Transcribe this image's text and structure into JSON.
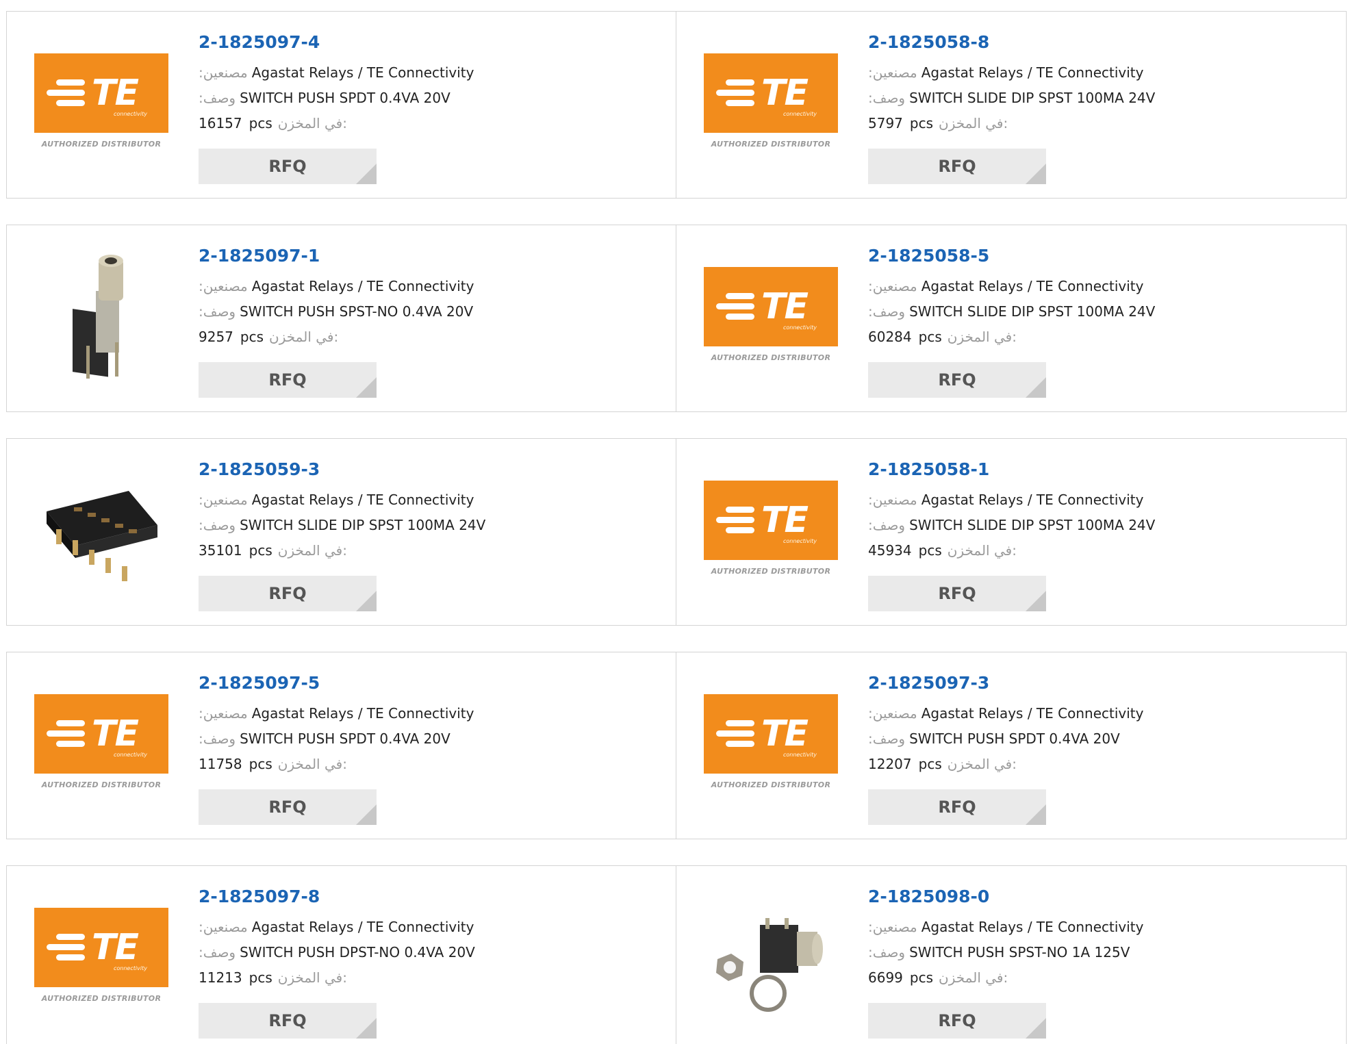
{
  "labels": {
    "manufacturer": ":مصنعين",
    "description": ":وصف",
    "stock": "في المخزن:",
    "unit": "pcs",
    "rfq": "RFQ"
  },
  "logo": {
    "word": "TE",
    "sub": "connectivity",
    "authorized": "AUTHORIZED DISTRIBUTOR",
    "accent": "#f28c1c"
  },
  "products": [
    {
      "part": "2-1825097-4",
      "manufacturer": "Agastat Relays / TE Connectivity",
      "description": "SWITCH PUSH SPDT 0.4VA 20V",
      "stock": "16157",
      "image": "te-logo"
    },
    {
      "part": "2-1825058-8",
      "manufacturer": "Agastat Relays / TE Connectivity",
      "description": "SWITCH SLIDE DIP SPST 100MA 24V",
      "stock": "5797",
      "image": "te-logo"
    },
    {
      "part": "2-1825097-1",
      "manufacturer": "Agastat Relays / TE Connectivity",
      "description": "SWITCH PUSH SPST-NO 0.4VA 20V",
      "stock": "9257",
      "image": "push-switch-photo"
    },
    {
      "part": "2-1825058-5",
      "manufacturer": "Agastat Relays / TE Connectivity",
      "description": "SWITCH SLIDE DIP SPST 100MA 24V",
      "stock": "60284",
      "image": "te-logo"
    },
    {
      "part": "2-1825059-3",
      "manufacturer": "Agastat Relays / TE Connectivity",
      "description": "SWITCH SLIDE DIP SPST 100MA 24V",
      "stock": "35101",
      "image": "dip-switch-photo"
    },
    {
      "part": "2-1825058-1",
      "manufacturer": "Agastat Relays / TE Connectivity",
      "description": "SWITCH SLIDE DIP SPST 100MA 24V",
      "stock": "45934",
      "image": "te-logo"
    },
    {
      "part": "2-1825097-5",
      "manufacturer": "Agastat Relays / TE Connectivity",
      "description": "SWITCH PUSH SPDT 0.4VA 20V",
      "stock": "11758",
      "image": "te-logo"
    },
    {
      "part": "2-1825097-3",
      "manufacturer": "Agastat Relays / TE Connectivity",
      "description": "SWITCH PUSH SPDT 0.4VA 20V",
      "stock": "12207",
      "image": "te-logo"
    },
    {
      "part": "2-1825097-8",
      "manufacturer": "Agastat Relays / TE Connectivity",
      "description": "SWITCH PUSH DPST-NO 0.4VA 20V",
      "stock": "11213",
      "image": "te-logo"
    },
    {
      "part": "2-1825098-0",
      "manufacturer": "Agastat Relays / TE Connectivity",
      "description": "SWITCH PUSH SPST-NO 1A 125V",
      "stock": "6699",
      "image": "switch-with-washers-photo"
    }
  ]
}
